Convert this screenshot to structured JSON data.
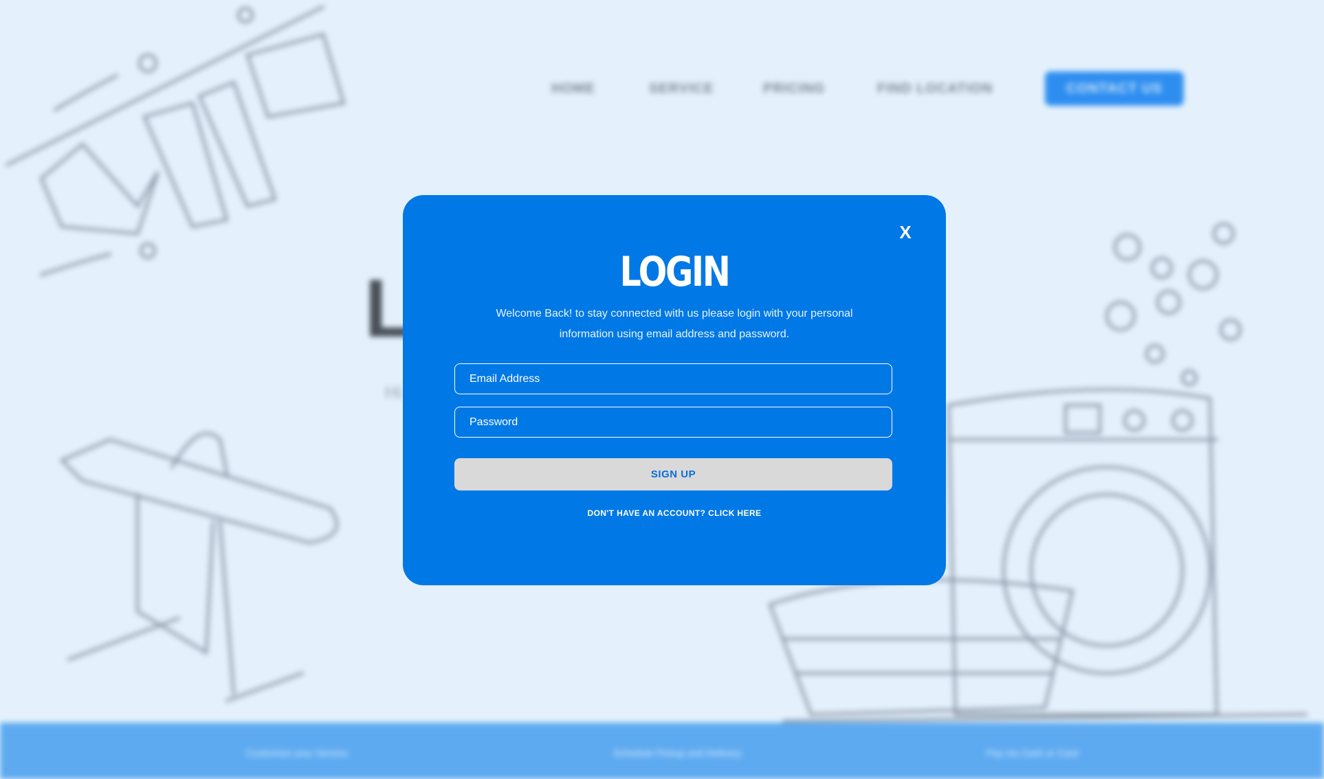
{
  "nav": {
    "items": [
      "HOME",
      "SERVICE",
      "PRICING",
      "FIND LOCATION"
    ],
    "contact_label": "CONTACT US"
  },
  "hero": {
    "title_fragment": "LA",
    "subtitle_fragment": "Hi"
  },
  "footer": {
    "items": [
      "Customize your Service",
      "Schedule Pickup and Delivery",
      "Pay via Cash or Card"
    ]
  },
  "modal": {
    "close_label": "X",
    "title": "LOGIN",
    "description": "Welcome Back! to stay connected  with us please login with your personal information using email address and password.",
    "email_placeholder": "Email Address",
    "password_placeholder": "Password",
    "signup_label": "SIGN UP",
    "account_prompt": "DON'T  HAVE  AN  ACCOUNT?",
    "click_here": "CLICK  HERE"
  },
  "colors": {
    "modal_bg": "#0078e6",
    "page_bg": "#e4f1fc",
    "footer_bg": "#5eaaf0",
    "button_bg": "#d9d9d9",
    "button_text": "#0a6ed8"
  }
}
